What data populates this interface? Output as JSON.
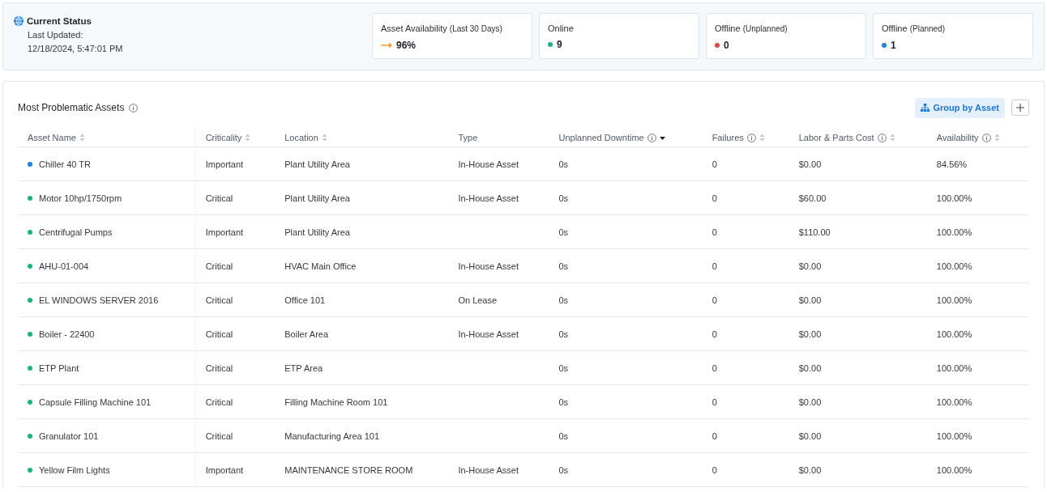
{
  "current_status": {
    "title": "Current Status",
    "updated_label": "Last Updated:",
    "updated_at": "12/18/2024, 5:47:01 PM"
  },
  "status_cards": [
    {
      "label": "Asset Availability",
      "note": "(Last 30 Days)",
      "kind": "trend",
      "color": "#f39a3c",
      "value": "96%"
    },
    {
      "label": "Online",
      "kind": "dot",
      "color": "#17b38b",
      "value": "9"
    },
    {
      "label": "Offline",
      "note": "(Unplanned)",
      "kind": "dot",
      "color": "#e5434c",
      "value": "0"
    },
    {
      "label": "Offline",
      "note": "(Planned)",
      "kind": "dot",
      "color": "#1f80e6",
      "value": "1"
    }
  ],
  "assets_panel": {
    "title": "Most Problematic Assets",
    "group_button": {
      "label": "Group by Asset"
    },
    "table": {
      "columns": [
        {
          "label": "Asset Name",
          "info": false,
          "sortable": true,
          "sorted": false
        },
        {
          "label": "Criticality",
          "info": false,
          "sortable": true,
          "sorted": false
        },
        {
          "label": "Location",
          "info": false,
          "sortable": true,
          "sorted": false
        },
        {
          "label": "Type",
          "info": false,
          "sortable": false
        },
        {
          "label": "Unplanned Downtime",
          "info": true,
          "sortable": true,
          "sorted": true
        },
        {
          "label": "Failures",
          "info": true,
          "sortable": true,
          "sorted": false
        },
        {
          "label": "Labor & Parts Cost",
          "info": true,
          "sortable": true,
          "sorted": false
        },
        {
          "label": "Availability",
          "info": true,
          "sortable": true,
          "sorted": false
        }
      ],
      "rows": [
        {
          "color": "#1f80e6",
          "cells": [
            "Chiller 40 TR",
            "Important",
            "Plant Utility Area",
            "In-House Asset",
            "0s",
            "0",
            "$0.00",
            "84.56%"
          ]
        },
        {
          "color": "#17b38b",
          "cells": [
            "Motor 10hp/1750rpm",
            "Critical",
            "Plant Utility Area",
            "In-House Asset",
            "0s",
            "0",
            "$60.00",
            "100.00%"
          ]
        },
        {
          "color": "#17b38b",
          "cells": [
            "Centrifugal Pumps",
            "Important",
            "Plant Utility Area",
            null,
            "0s",
            "0",
            "$110.00",
            "100.00%"
          ]
        },
        {
          "color": "#17b38b",
          "cells": [
            "AHU-01-004",
            "Critical",
            "HVAC Main Office",
            "In-House Asset",
            "0s",
            "0",
            "$0.00",
            "100.00%"
          ]
        },
        {
          "color": "#17b38b",
          "cells": [
            "EL WINDOWS SERVER 2016",
            "Critical",
            "Office 101",
            "On Lease",
            "0s",
            "0",
            "$0.00",
            "100.00%"
          ]
        },
        {
          "color": "#17b38b",
          "cells": [
            "Boiler - 22400",
            "Critical",
            "Boiler Area",
            "In-House Asset",
            "0s",
            "0",
            "$0.00",
            "100.00%"
          ]
        },
        {
          "color": "#17b38b",
          "cells": [
            "ETP Plant",
            "Critical",
            "ETP Area",
            null,
            "0s",
            "0",
            "$0.00",
            "100.00%"
          ]
        },
        {
          "color": "#17b38b",
          "cells": [
            "Capsule Filling Machine 101",
            "Critical",
            "Filling Machine Room 101",
            null,
            "0s",
            "0",
            "$0.00",
            "100.00%"
          ]
        },
        {
          "color": "#17b38b",
          "cells": [
            "Granulator 101",
            "Critical",
            "Manufacturing Area 101",
            null,
            "0s",
            "0",
            "$0.00",
            "100.00%"
          ]
        },
        {
          "color": "#17b38b",
          "cells": [
            "Yellow Film Lights",
            "Important",
            "MAINTENANCE STORE ROOM",
            "In-House Asset",
            "0s",
            "0",
            "$0.00",
            "100.00%"
          ]
        }
      ]
    }
  }
}
